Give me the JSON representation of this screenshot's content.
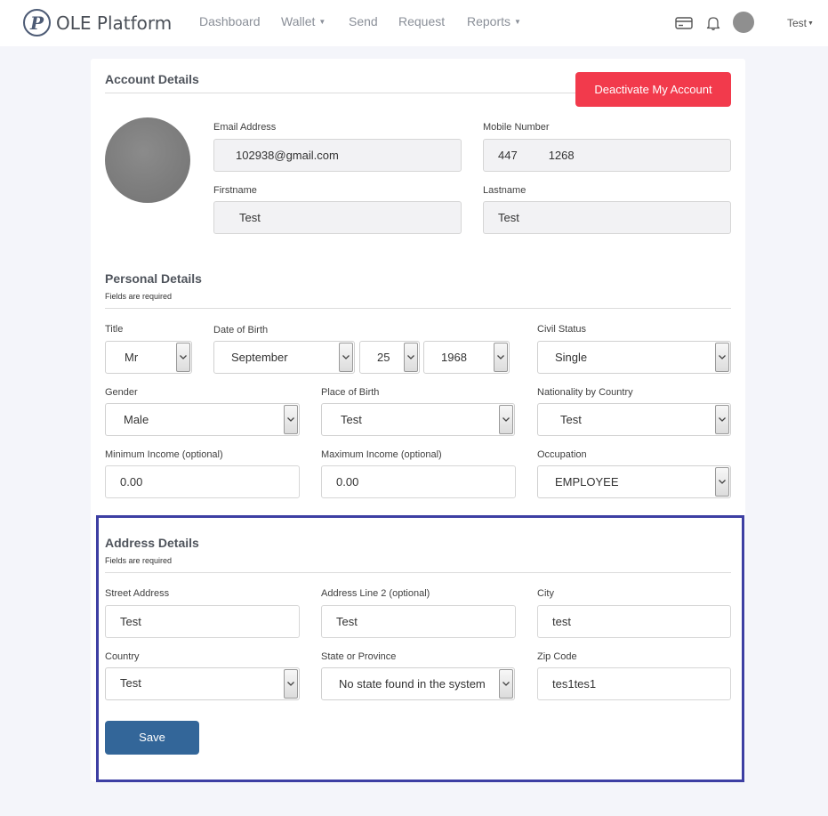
{
  "app": {
    "logo_letter": "P",
    "brand": "OLE Platform"
  },
  "nav": {
    "items": [
      {
        "label": "Dashboard",
        "has_caret": false
      },
      {
        "label": "Wallet",
        "has_caret": true
      },
      {
        "label": "Send",
        "has_caret": false
      },
      {
        "label": "Request",
        "has_caret": false
      },
      {
        "label": "Reports",
        "has_caret": true
      }
    ],
    "icons": [
      "card-icon",
      "bell-icon"
    ],
    "user_label": "Test"
  },
  "account": {
    "title": "Account Details",
    "deactivate_label": "Deactivate My Account",
    "email_label": "Email Address",
    "email_value": "102938@gmail.com",
    "mobile_label": "Mobile Number",
    "mobile_prefix": "447",
    "mobile_suffix": "1268",
    "firstname_label": "Firstname",
    "firstname_value": "Test",
    "lastname_label": "Lastname",
    "lastname_value": "Test"
  },
  "personal": {
    "title": "Personal Details",
    "subtitle": "Fields are required",
    "title_label": "Title",
    "title_value": "Mr",
    "dob_label": "Date of Birth",
    "dob_month": "September",
    "dob_day": "25",
    "dob_year": "1968",
    "civil_label": "Civil Status",
    "civil_value": "Single",
    "gender_label": "Gender",
    "gender_value": "Male",
    "pob_label": "Place of Birth",
    "pob_value": "Test",
    "nationality_label": "Nationality by Country",
    "nationality_value": "Test",
    "min_income_label": "Minimum Income (optional)",
    "min_income_value": "0.00",
    "max_income_label": "Maximum Income (optional)",
    "max_income_value": "0.00",
    "occupation_label": "Occupation",
    "occupation_value": "EMPLOYEE"
  },
  "address": {
    "title": "Address Details",
    "subtitle": "Fields are required",
    "street_label": "Street Address",
    "street_value": "Test",
    "line2_label": "Address Line 2 (optional)",
    "line2_value": "Test",
    "city_label": "City",
    "city_value": "test",
    "country_label": "Country",
    "country_value": "Test",
    "state_label": "State or Province",
    "state_value": "No state found in the system",
    "zip_label": "Zip Code",
    "zip_value": "tes1tes1",
    "save_label": "Save"
  },
  "colors": {
    "danger": "#f23a4c",
    "primary": "#336699",
    "highlight": "#3d3fa3"
  }
}
